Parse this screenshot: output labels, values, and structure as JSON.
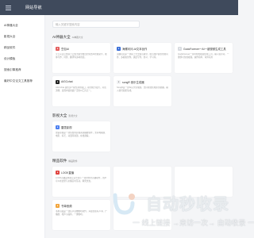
{
  "header": {
    "logo": "网站导航",
    "menu_icon": "hamburger-icon"
  },
  "sidebar": {
    "items": [
      {
        "label": "AI神器大全"
      },
      {
        "label": "影视大全"
      },
      {
        "label": "精品软件"
      },
      {
        "label": "设计模板"
      },
      {
        "label": "搜索引擎推荐"
      },
      {
        "label": "最好中文论文工具推荐"
      }
    ]
  },
  "search": {
    "placeholder": "输入关键字搜索内容"
  },
  "sections": [
    {
      "title": "AI神器大全",
      "sub": "AI神器大全",
      "cards": [
        {
          "title": "豆包AI",
          "desc": "字节火山引擎基于云雀大模型推出的免费AI智能助手，能够写作、问答、翻译等多种用途。",
          "icon_color": "#e45d5d",
          "icon": "doubao-icon"
        },
        {
          "title": "海螺问问-AI文本创作",
          "desc": "海螺问问是一款基于大型语言模型，能为用户提供智能问答、多模态创作，涵盖写作、办公、学习等。",
          "icon_color": "#3b6fd8",
          "icon": "hailuo-icon"
        },
        {
          "title": "GodoForever一AI一键视频生成工具",
          "desc": "GodoForever一款AI智能视频生成工具，输入提示词，一键即可生成视频，操作简单，海外可用",
          "icon_color": "#d8dbe0",
          "icon": "godo-icon"
        },
        {
          "title": "AiGCchat",
          "desc": "AiGCchat 提供多个模型调用接口，模型能力强大，对话流畅，是国内使用最广泛的AI工具之一。",
          "icon_color": "#222222",
          "icon": "aigc-icon"
        },
        {
          "title": "songR 音乐生成器",
          "desc": "SongR是一款AI音乐生成器，支持在线生成原创歌曲，输入歌词就能生成。",
          "icon_color": "#f1f2f4",
          "icon": "songr-icon"
        }
      ]
    },
    {
      "title": "影视大全",
      "sub": "影视大全",
      "cards": [
        {
          "title": "雷霆影视",
          "desc": "雷霆影视是一款免费的影视资源播放软件，支持电视剧、电影、综艺、动漫等资源，在线观看。",
          "icon_color": "#4c7ff0",
          "icon": "leiting-icon"
        }
      ]
    },
    {
      "title": "精品软件",
      "sub": "精品软件",
      "cards": [
        {
          "title": "LOOK直播",
          "desc": "LOOK直播是网易云音乐旗下一款社交型直播软件，用户可以在这里与主播实时互动，聊天交友。",
          "icon_color": "#e0433f",
          "icon": "look-icon"
        },
        {
          "title": "",
          "desc": "",
          "icon_color": "",
          "icon": ""
        },
        {
          "title": "",
          "desc": "",
          "icon_color": "",
          "icon": ""
        },
        {
          "title": "书单音频",
          "desc": "书单音频是一款有声读物收听软件，海量优质有声书、广播剧、相声小品等，一键收听。",
          "icon_color": "#f2a43a",
          "icon": "shudan-icon"
        },
        {
          "title": "",
          "desc": "",
          "icon_color": "",
          "icon": ""
        }
      ]
    }
  ],
  "watermark": {
    "text": "自动秒收录",
    "slogan": "一 线上链接 →来访一次→ 自动收录 一"
  }
}
